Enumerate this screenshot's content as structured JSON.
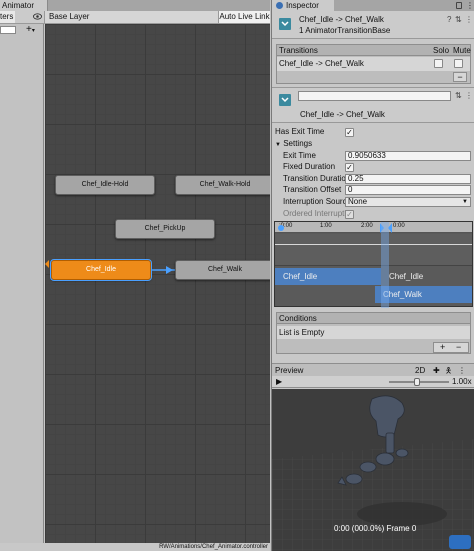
{
  "animator": {
    "tab_label": "Animator",
    "params_tab": "ters",
    "layer_label": "Base Layer",
    "auto_live_link": "Auto Live Link",
    "plus_label": "+",
    "footer_path": "RW/Animations/Chef_Animator.controller",
    "nodes": [
      {
        "label": "Chef_Idle-Hold",
        "state": "normal"
      },
      {
        "label": "Chef_Walk-Hold",
        "state": "normal"
      },
      {
        "label": "Chef_PickUp",
        "state": "normal"
      },
      {
        "label": "Chef_Idle",
        "state": "default"
      },
      {
        "label": "Chef_Walk",
        "state": "selected"
      }
    ]
  },
  "inspector": {
    "tab_label": "Inspector",
    "header_title": "Chef_Idle -> Chef_Walk",
    "header_subtitle": "1 AnimatorTransitionBase",
    "transitions": {
      "title": "Transitions",
      "solo_label": "Solo",
      "mute_label": "Mute",
      "rows": [
        {
          "label": "Chef_Idle -> Chef_Walk",
          "solo": false,
          "mute": false
        }
      ],
      "minus_label": "−"
    },
    "transition_name": "Chef_Idle -> Chef_Walk",
    "has_exit_time": {
      "label": "Has Exit Time",
      "checked": true
    },
    "settings": {
      "label": "Settings",
      "exit_time": {
        "label": "Exit Time",
        "value": "0.9050633"
      },
      "fixed_duration": {
        "label": "Fixed Duration",
        "checked": true
      },
      "transition_duration": {
        "label": "Transition Duratio",
        "value": "0.25"
      },
      "transition_offset": {
        "label": "Transition Offset",
        "value": "0"
      },
      "interruption_source": {
        "label": "Interruption Source",
        "value": "None"
      },
      "ordered_interruption": {
        "label": "Ordered Interruptio",
        "checked": true
      }
    },
    "timeline": {
      "ticks": [
        ":0:00",
        "1:00",
        "2:00",
        "0:00"
      ],
      "track_source": "Chef_Idle",
      "track_source2": "Chef_Idle",
      "track_dest": "Chef_Walk"
    },
    "conditions": {
      "title": "Conditions",
      "empty_text": "List is Empty",
      "add_label": "+",
      "remove_label": "−"
    },
    "preview": {
      "title": "Preview",
      "mode_2d": "2D",
      "speed": "1.00x",
      "play_glyph": "▶",
      "frame_text": "0:00 (000.0%) Frame 0"
    }
  },
  "colors": {
    "default_state": "#ee8b19",
    "selection": "#4aa0ff",
    "graph_bg": "#474747"
  }
}
